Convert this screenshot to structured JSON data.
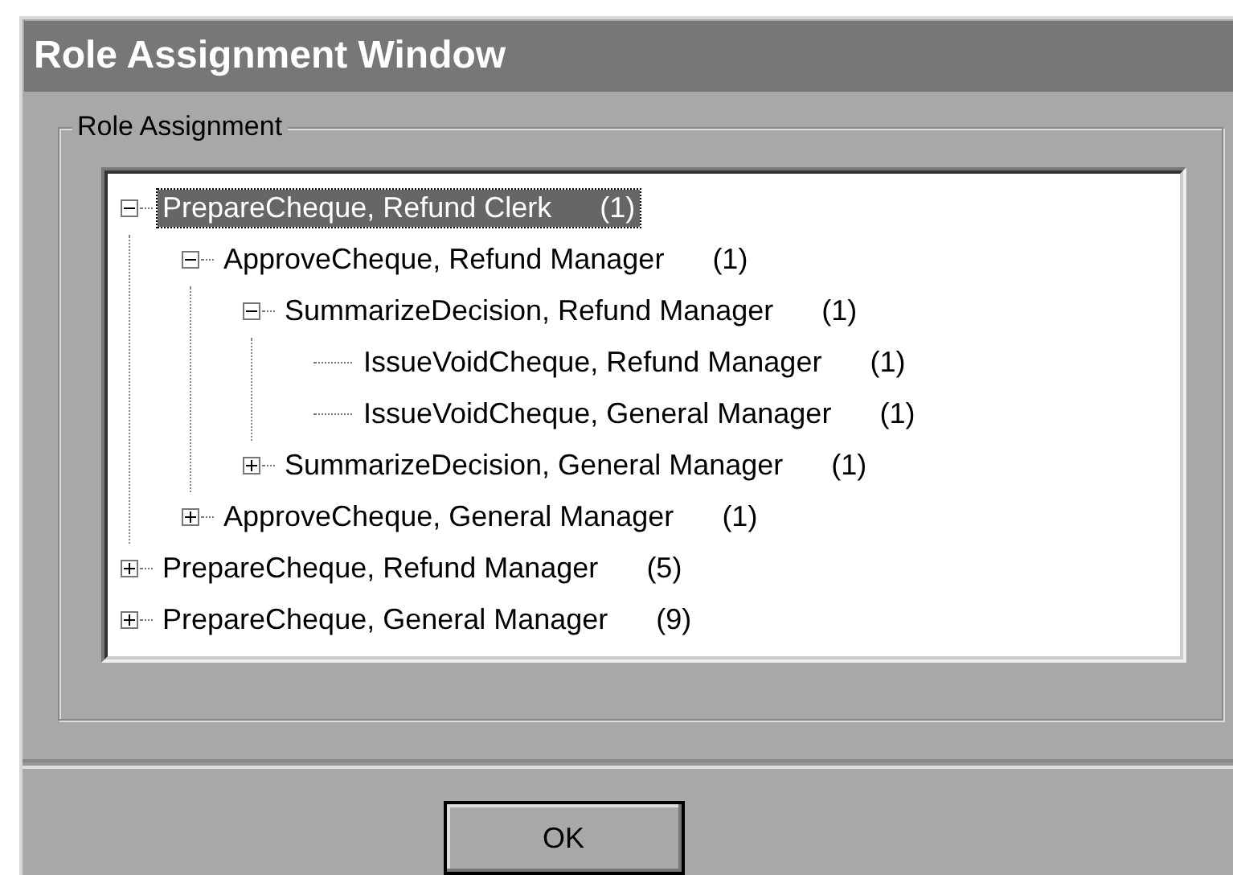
{
  "window": {
    "title": "Role Assignment Window"
  },
  "group": {
    "label": "Role Assignment"
  },
  "tree": [
    {
      "name": "PrepareCheque, Refund Clerk",
      "count": "(1)",
      "selected": true,
      "expanded": true,
      "children": [
        {
          "name": "ApproveCheque, Refund Manager",
          "count": "(1)",
          "selected": false,
          "expanded": true,
          "children": [
            {
              "name": "SummarizeDecision, Refund Manager",
              "count": "(1)",
              "selected": false,
              "expanded": true,
              "children": [
                {
                  "name": "IssueVoidCheque, Refund Manager",
                  "count": "(1)",
                  "selected": false
                },
                {
                  "name": "IssueVoidCheque, General Manager",
                  "count": "(1)",
                  "selected": false
                }
              ]
            },
            {
              "name": "SummarizeDecision, General Manager",
              "count": "(1)",
              "selected": false,
              "expanded": false
            }
          ]
        },
        {
          "name": "ApproveCheque, General Manager",
          "count": "(1)",
          "selected": false,
          "expanded": false
        }
      ]
    },
    {
      "name": "PrepareCheque, Refund Manager",
      "count": "(5)",
      "selected": false,
      "expanded": false
    },
    {
      "name": "PrepareCheque, General Manager",
      "count": "(9)",
      "selected": false,
      "expanded": false
    }
  ],
  "buttons": [
    "OK"
  ]
}
